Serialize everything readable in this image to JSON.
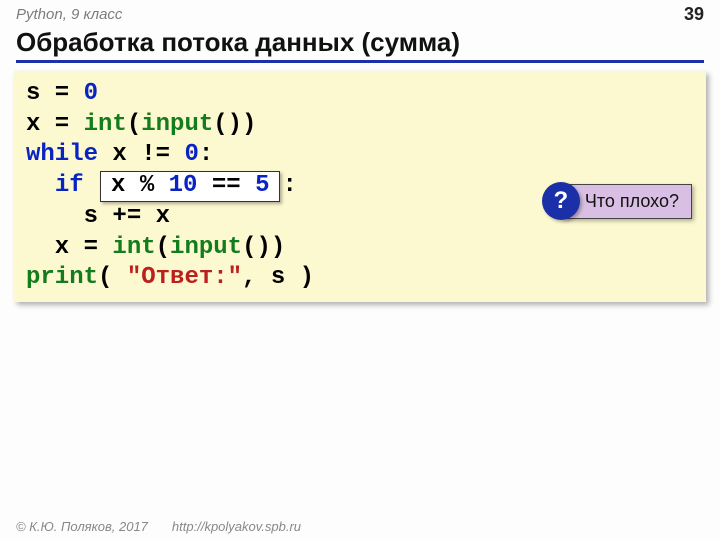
{
  "header": {
    "course": "Python, 9 класс",
    "page_number": "39"
  },
  "title": "Обработка потока данных (сумма)",
  "code": {
    "l1_a": "s",
    "l1_b": " = ",
    "l1_c": "0",
    "l2_a": "x = ",
    "l2_b": "int",
    "l2_c": "(",
    "l2_d": "input",
    "l2_e": "())",
    "l3_a": "while",
    "l3_b": " x != ",
    "l3_c": "0",
    "l3_d": ":",
    "l4_a": "  ",
    "l4_b": "if",
    "l4_c": " ",
    "l4_box_a": "x % ",
    "l4_box_b": "10",
    "l4_box_c": " == ",
    "l4_box_d": "5",
    "l4_e": ":",
    "l5": "    s += x",
    "l6_a": "  x = ",
    "l6_b": "int",
    "l6_c": "(",
    "l6_d": "input",
    "l6_e": "())",
    "l7_a": "print",
    "l7_b": "( ",
    "l7_c": "\"Ответ:\"",
    "l7_d": ", s )"
  },
  "callout": {
    "badge": "?",
    "text": "Что плохо?"
  },
  "footer": {
    "copyright": "© К.Ю. Поляков, 2017",
    "url": "http://kpolyakov.spb.ru"
  }
}
